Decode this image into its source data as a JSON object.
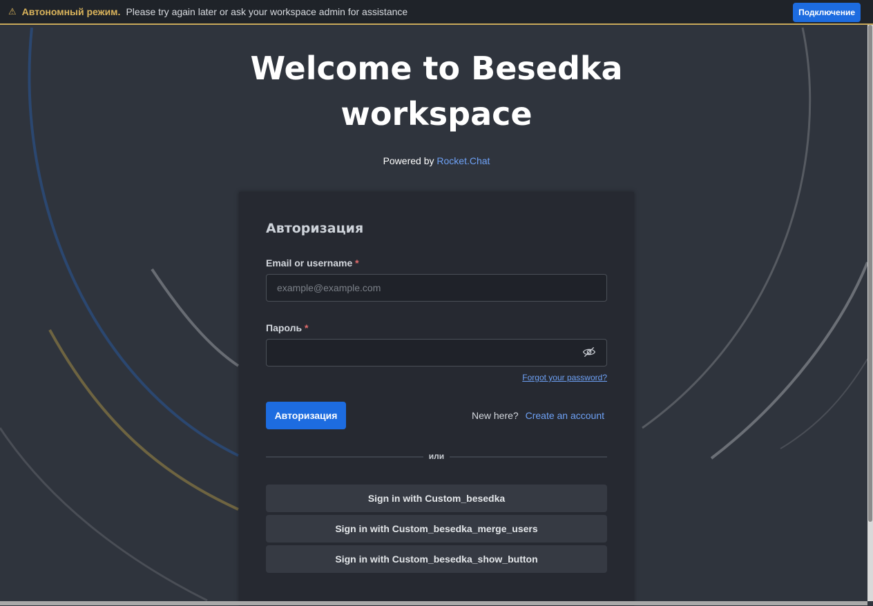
{
  "banner": {
    "icon": "warning-icon",
    "mode": "Автономный режим.",
    "message": "Please try again later or ask your workspace admin for assistance",
    "connect_label": "Подключение"
  },
  "header": {
    "title_line1": "Welcome to Besedka",
    "title_line2": "workspace",
    "powered_prefix": "Powered by",
    "powered_link": "Rocket.Chat"
  },
  "login": {
    "heading": "Авторизация",
    "email_label": "Email or username",
    "email_placeholder": "example@example.com",
    "required_mark": "*",
    "password_label": "Пароль",
    "password_icon": "eye-slash-icon",
    "forgot": "Forgot your password?",
    "submit": "Авторизация",
    "new_here": "New here?",
    "create_account": "Create an account",
    "divider": "или",
    "oauth": [
      "Sign in with Custom_besedka",
      "Sign in with Custom_besedka_merge_users",
      "Sign in with Custom_besedka_show_button"
    ]
  },
  "colors": {
    "background": "#2f343d",
    "card": "#262931",
    "primary": "#1d6ce0",
    "link": "#6ea1f5",
    "banner_accent": "#d9b35b"
  }
}
